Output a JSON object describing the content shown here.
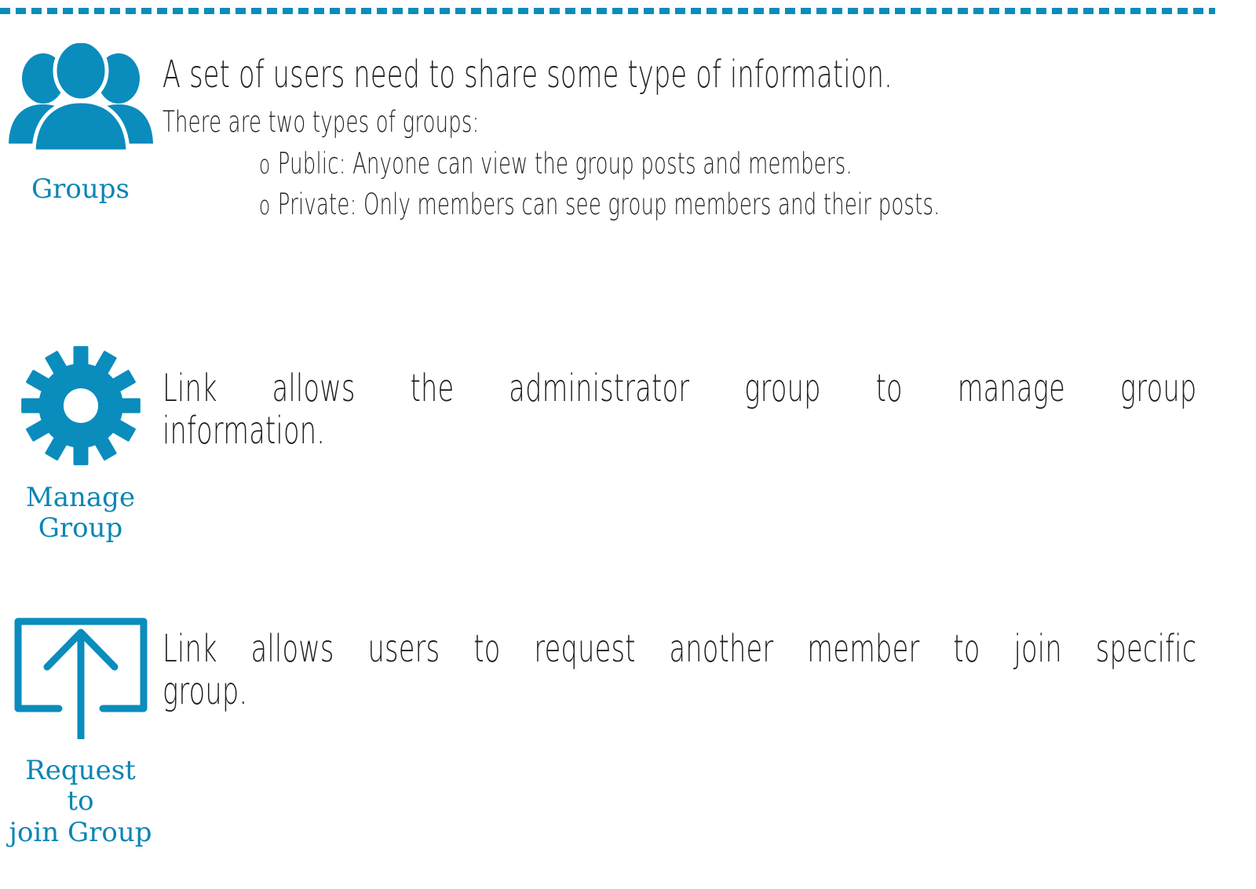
{
  "theme": {
    "accent_blue": "#0a8cbd",
    "caption_blue": "#0a85b5",
    "body_text": "#231f20",
    "background": "#ffffff"
  },
  "top_rule": {
    "style": "dashed",
    "color": "#0a8cbd"
  },
  "features": [
    {
      "icon": "group-of-users-icon",
      "caption": "Groups",
      "lead": "A set of users need to share some type of information.",
      "sub": "There are two types of groups:",
      "bullet_marker": "o",
      "bullets": [
        "Public: Anyone can view the group posts and members.",
        "Private: Only members can see group members and their posts."
      ]
    },
    {
      "icon": "gear-icon",
      "caption": "Manage\nGroup",
      "paragraph_lines": [
        "Link allows the administrator group to manage group",
        "information."
      ]
    },
    {
      "icon": "upload-box-arrow-icon",
      "caption": "Request\nto\njoin Group",
      "paragraph_lines": [
        "Link allows users to request another member to join specific",
        "group."
      ]
    }
  ]
}
